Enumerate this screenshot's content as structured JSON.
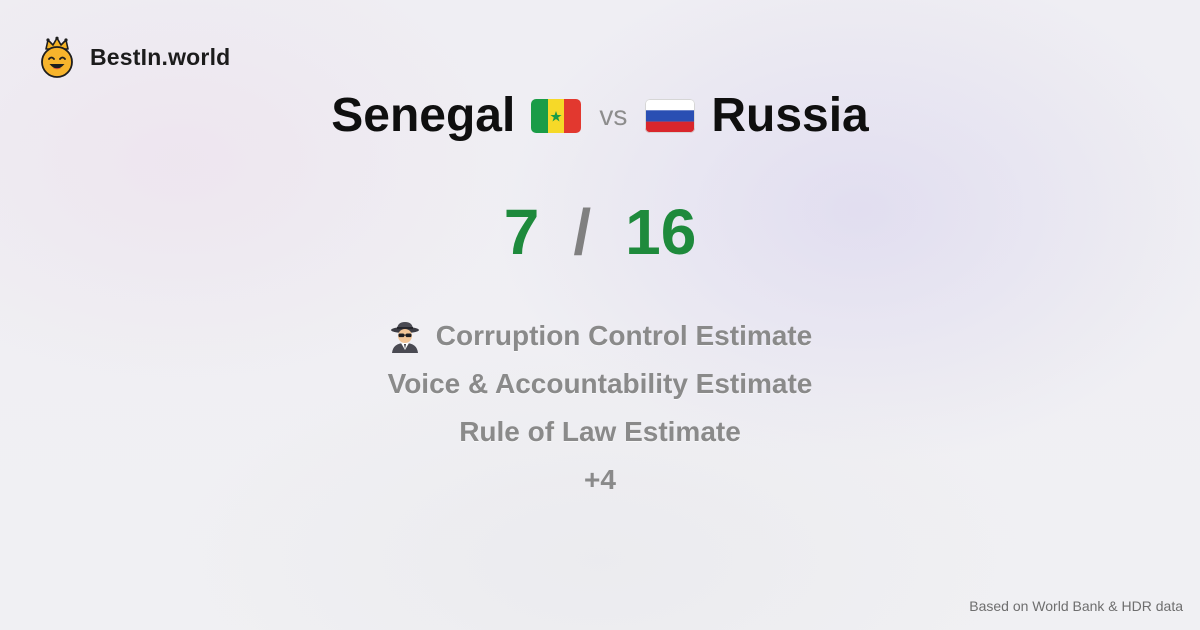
{
  "brand": {
    "name": "BestIn.world",
    "logo_icon": "crowned-smiley-icon"
  },
  "comparison": {
    "left_country": "Senegal",
    "left_flag_icon": "senegal-flag-icon",
    "vs_label": "vs",
    "right_country": "Russia",
    "right_flag_icon": "russia-flag-icon"
  },
  "score": {
    "left": "7",
    "separator": "/",
    "right": "16",
    "color": "#1e8a3c"
  },
  "metrics": {
    "items": [
      {
        "label": "Corruption Control Estimate",
        "icon": "detective-icon"
      },
      {
        "label": "Voice & Accountability Estimate"
      },
      {
        "label": "Rule of Law Estimate"
      }
    ],
    "more_label": "+4"
  },
  "footer": {
    "source_text": "Based on World Bank & HDR data"
  }
}
